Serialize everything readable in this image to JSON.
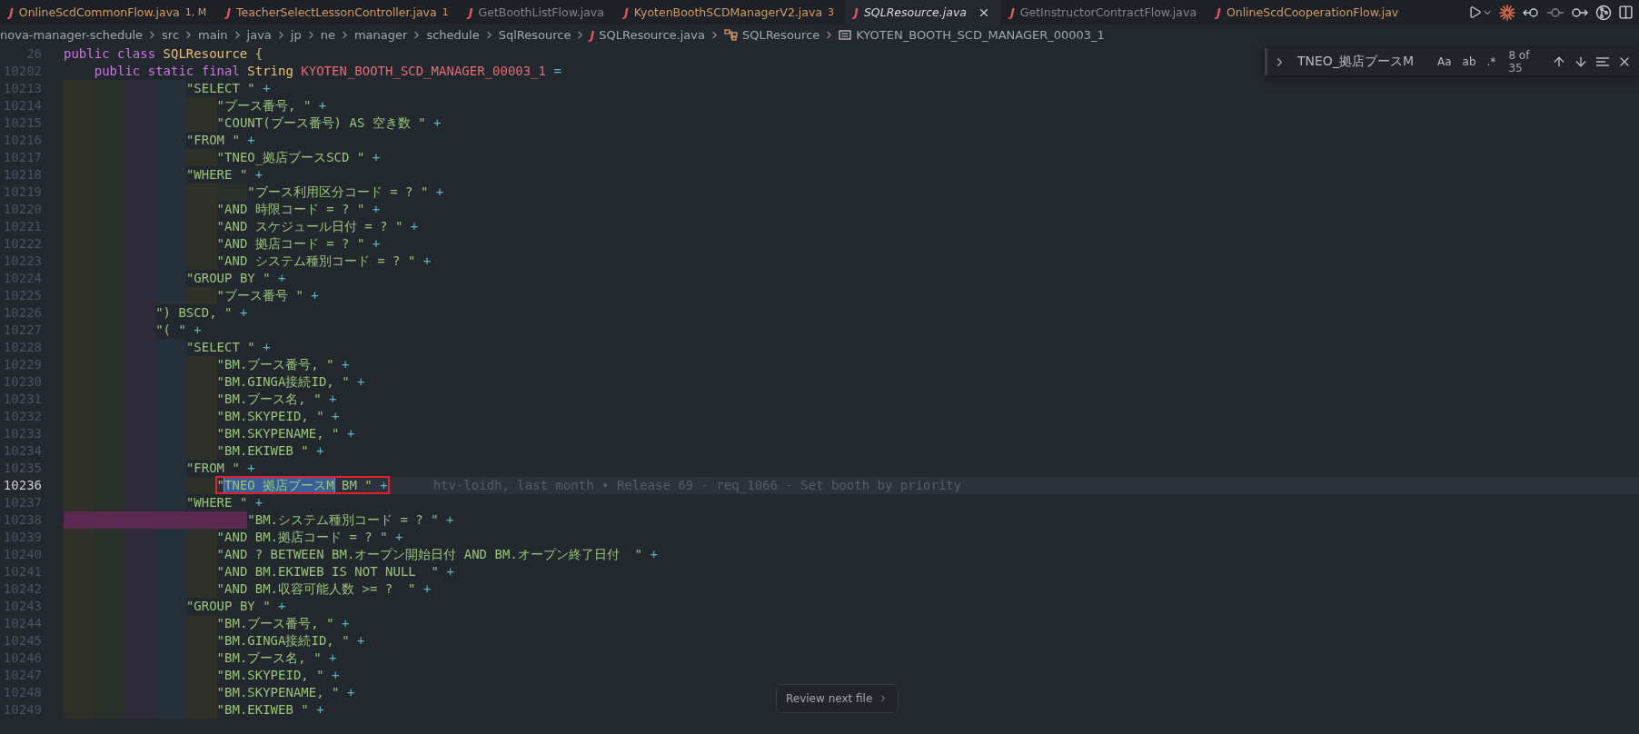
{
  "tabs": [
    {
      "icon": "J",
      "label": "OnlineScdCommonFlow.java",
      "badge": "1, M",
      "warning": true,
      "selected": false,
      "preview": false
    },
    {
      "icon": "J",
      "label": "TeacherSelectLessonController.java",
      "badge": "1",
      "warning": true,
      "selected": false,
      "preview": false
    },
    {
      "icon": "J",
      "label": "GetBoothListFlow.java",
      "warning": false,
      "selected": false,
      "preview": false
    },
    {
      "icon": "J",
      "label": "KyotenBoothSCDManagerV2.java",
      "badge": "3",
      "warning": true,
      "selected": false,
      "preview": false
    },
    {
      "icon": "J",
      "label": "SQLResource.java",
      "warning": false,
      "selected": true,
      "preview": true
    },
    {
      "icon": "J",
      "label": "GetInstructorContractFlow.java",
      "warning": false,
      "selected": false,
      "preview": false
    },
    {
      "icon": "J",
      "label": "OnlineScdCooperationFlow.jav",
      "warning": true,
      "selected": false,
      "preview": false
    }
  ],
  "breadcrumb": [
    {
      "kind": "folder",
      "label": "nova-manager-schedule"
    },
    {
      "kind": "folder",
      "label": "src"
    },
    {
      "kind": "folder",
      "label": "main"
    },
    {
      "kind": "folder",
      "label": "java"
    },
    {
      "kind": "folder",
      "label": "jp"
    },
    {
      "kind": "folder",
      "label": "ne"
    },
    {
      "kind": "folder",
      "label": "manager"
    },
    {
      "kind": "folder",
      "label": "schedule"
    },
    {
      "kind": "folder",
      "label": "SqlResource"
    },
    {
      "kind": "file",
      "icon": "J",
      "label": "SQLResource.java"
    },
    {
      "kind": "class",
      "label": "SQLResource"
    },
    {
      "kind": "field",
      "label": "KYOTEN_BOOTH_SCD_MANAGER_00003_1"
    }
  ],
  "find": {
    "expanded": false,
    "query": "TNEO_拠店ブースM",
    "options": [
      {
        "label": "Aa",
        "on": false
      },
      {
        "label": "ab",
        "on": false
      },
      {
        "label": ".*",
        "on": false
      }
    ],
    "count": "8 of 35"
  },
  "lines": [
    {
      "number": "26",
      "kind": "none",
      "current": false,
      "tokens": [
        {
          "kind": "keyword",
          "text": "public class "
        },
        {
          "kind": "type",
          "text": "SQLResource "
        },
        {
          "kind": "punct",
          "text": "{"
        }
      ]
    },
    {
      "number": "10202",
      "kind": "plain1",
      "current": false,
      "tokens": [
        {
          "kind": "keyword",
          "text": "public static final "
        },
        {
          "kind": "type",
          "text": "String "
        },
        {
          "kind": "constant",
          "text": "KYOTEN_BOOTH_SCD_MANAGER_00003_1"
        },
        {
          "kind": "op",
          "text": " ="
        }
      ]
    },
    {
      "number": "10213",
      "kind": "guides4",
      "current": false,
      "tokens": [
        {
          "kind": "string",
          "text": "\"SELECT \""
        },
        {
          "kind": "op",
          "text": " +"
        }
      ]
    },
    {
      "number": "10214",
      "kind": "guides5",
      "current": false,
      "tokens": [
        {
          "kind": "string",
          "text": "\"ブース番号, \""
        },
        {
          "kind": "op",
          "text": " +"
        }
      ]
    },
    {
      "number": "10215",
      "kind": "guides5",
      "current": false,
      "tokens": [
        {
          "kind": "string",
          "text": "\"COUNT(ブース番号) AS 空き数 \""
        },
        {
          "kind": "op",
          "text": " +"
        }
      ]
    },
    {
      "number": "10216",
      "kind": "guides4",
      "current": false,
      "tokens": [
        {
          "kind": "string",
          "text": "\"FROM \""
        },
        {
          "kind": "op",
          "text": " +"
        }
      ]
    },
    {
      "number": "10217",
      "kind": "guides5",
      "current": false,
      "tokens": [
        {
          "kind": "string",
          "text": "\"TNEO_拠店ブースSCD \""
        },
        {
          "kind": "op",
          "text": " +"
        }
      ]
    },
    {
      "number": "10218",
      "kind": "guides4",
      "current": false,
      "tokens": [
        {
          "kind": "string",
          "text": "\"WHERE \""
        },
        {
          "kind": "op",
          "text": " +"
        }
      ]
    },
    {
      "number": "10219",
      "kind": "guides6",
      "current": false,
      "tokens": [
        {
          "kind": "string",
          "text": "\"ブース利用区分コード = ? \""
        },
        {
          "kind": "op",
          "text": " +"
        }
      ]
    },
    {
      "number": "10220",
      "kind": "guides5",
      "current": false,
      "tokens": [
        {
          "kind": "string",
          "text": "\"AND 時限コード = ? \""
        },
        {
          "kind": "op",
          "text": " +"
        }
      ]
    },
    {
      "number": "10221",
      "kind": "guides5",
      "current": false,
      "tokens": [
        {
          "kind": "string",
          "text": "\"AND スケジュール日付 = ? \""
        },
        {
          "kind": "op",
          "text": " +"
        }
      ]
    },
    {
      "number": "10222",
      "kind": "guides5",
      "current": false,
      "tokens": [
        {
          "kind": "string",
          "text": "\"AND 拠店コード = ? \""
        },
        {
          "kind": "op",
          "text": " +"
        }
      ]
    },
    {
      "number": "10223",
      "kind": "guides5",
      "current": false,
      "tokens": [
        {
          "kind": "string",
          "text": "\"AND システム種別コード = ? \""
        },
        {
          "kind": "op",
          "text": " +"
        }
      ]
    },
    {
      "number": "10224",
      "kind": "guides4",
      "current": false,
      "tokens": [
        {
          "kind": "string",
          "text": "\"GROUP BY \""
        },
        {
          "kind": "op",
          "text": " +"
        }
      ]
    },
    {
      "number": "10225",
      "kind": "guides5",
      "current": false,
      "tokens": [
        {
          "kind": "string",
          "text": "\"ブース番号 \""
        },
        {
          "kind": "op",
          "text": " +"
        }
      ]
    },
    {
      "number": "10226",
      "kind": "guides3",
      "current": false,
      "tokens": [
        {
          "kind": "string",
          "text": "\") BSCD, \""
        },
        {
          "kind": "op",
          "text": " +"
        }
      ]
    },
    {
      "number": "10227",
      "kind": "guides3",
      "current": false,
      "tokens": [
        {
          "kind": "string",
          "text": "\"( \""
        },
        {
          "kind": "op",
          "text": " +"
        }
      ]
    },
    {
      "number": "10228",
      "kind": "guides4",
      "current": false,
      "tokens": [
        {
          "kind": "string",
          "text": "\"SELECT \""
        },
        {
          "kind": "op",
          "text": " +"
        }
      ]
    },
    {
      "number": "10229",
      "kind": "guides5",
      "current": false,
      "tokens": [
        {
          "kind": "string",
          "text": "\"BM.ブース番号, \""
        },
        {
          "kind": "op",
          "text": " +"
        }
      ]
    },
    {
      "number": "10230",
      "kind": "guides5",
      "current": false,
      "tokens": [
        {
          "kind": "string",
          "text": "\"BM.GINGA接続ID, \""
        },
        {
          "kind": "op",
          "text": " +"
        }
      ]
    },
    {
      "number": "10231",
      "kind": "guides5",
      "current": false,
      "tokens": [
        {
          "kind": "string",
          "text": "\"BM.ブース名, \""
        },
        {
          "kind": "op",
          "text": " +"
        }
      ]
    },
    {
      "number": "10232",
      "kind": "guides5",
      "current": false,
      "tokens": [
        {
          "kind": "string",
          "text": "\"BM.SKYPEID, \""
        },
        {
          "kind": "op",
          "text": " +"
        }
      ]
    },
    {
      "number": "10233",
      "kind": "guides5",
      "current": false,
      "tokens": [
        {
          "kind": "string",
          "text": "\"BM.SKYPENAME, \""
        },
        {
          "kind": "op",
          "text": " +"
        }
      ]
    },
    {
      "number": "10234",
      "kind": "guides5",
      "current": false,
      "tokens": [
        {
          "kind": "string",
          "text": "\"BM.EKIWEB \""
        },
        {
          "kind": "op",
          "text": " +"
        }
      ]
    },
    {
      "number": "10235",
      "kind": "guides4",
      "current": false,
      "tokens": [
        {
          "kind": "string",
          "text": "\"FROM \""
        },
        {
          "kind": "op",
          "text": " +"
        }
      ]
    },
    {
      "number": "10236",
      "kind": "guides5",
      "current": true,
      "boxed": true,
      "blame": "htv-loidh, last month • Release 69 - req_1066 - Set booth by priority",
      "tokens": [
        {
          "kind": "string",
          "text": "\""
        },
        {
          "kind": "match",
          "text": "TNEO_拠店ブースM"
        },
        {
          "kind": "string",
          "text": " BM \""
        },
        {
          "kind": "op",
          "text": " +"
        }
      ]
    },
    {
      "number": "10237",
      "kind": "guides4",
      "current": false,
      "tokens": [
        {
          "kind": "string",
          "text": "\"WHERE \""
        },
        {
          "kind": "op",
          "text": " +"
        }
      ]
    },
    {
      "number": "10238",
      "kind": "error6",
      "current": false,
      "tokens": [
        {
          "kind": "string",
          "text": "\"BM.システム種別コード = ? \""
        },
        {
          "kind": "op",
          "text": " +"
        }
      ]
    },
    {
      "number": "10239",
      "kind": "guides5",
      "current": false,
      "tokens": [
        {
          "kind": "string",
          "text": "\"AND BM.拠店コード = ? \""
        },
        {
          "kind": "op",
          "text": " +"
        }
      ]
    },
    {
      "number": "10240",
      "kind": "guides5",
      "current": false,
      "tokens": [
        {
          "kind": "string",
          "text": "\"AND ? BETWEEN BM.オープン開始日付 AND BM.オープン終了日付  \""
        },
        {
          "kind": "op",
          "text": " +"
        }
      ]
    },
    {
      "number": "10241",
      "kind": "guides5",
      "current": false,
      "tokens": [
        {
          "kind": "string",
          "text": "\"AND BM.EKIWEB IS NOT NULL  \""
        },
        {
          "kind": "op",
          "text": " +"
        }
      ]
    },
    {
      "number": "10242",
      "kind": "guides5",
      "current": false,
      "tokens": [
        {
          "kind": "string",
          "text": "\"AND BM.収容可能人数 >= ?  \""
        },
        {
          "kind": "op",
          "text": " +"
        }
      ]
    },
    {
      "number": "10243",
      "kind": "guides4",
      "current": false,
      "tokens": [
        {
          "kind": "string",
          "text": "\"GROUP BY \""
        },
        {
          "kind": "op",
          "text": " +"
        }
      ]
    },
    {
      "number": "10244",
      "kind": "guides5",
      "current": false,
      "tokens": [
        {
          "kind": "string",
          "text": "\"BM.ブース番号, \""
        },
        {
          "kind": "op",
          "text": " +"
        }
      ]
    },
    {
      "number": "10245",
      "kind": "guides5",
      "current": false,
      "tokens": [
        {
          "kind": "string",
          "text": "\"BM.GINGA接続ID, \""
        },
        {
          "kind": "op",
          "text": " +"
        }
      ]
    },
    {
      "number": "10246",
      "kind": "guides5",
      "current": false,
      "tokens": [
        {
          "kind": "string",
          "text": "\"BM.ブース名, \""
        },
        {
          "kind": "op",
          "text": " +"
        }
      ]
    },
    {
      "number": "10247",
      "kind": "guides5",
      "current": false,
      "tokens": [
        {
          "kind": "string",
          "text": "\"BM.SKYPEID, \""
        },
        {
          "kind": "op",
          "text": " +"
        }
      ]
    },
    {
      "number": "10248",
      "kind": "guides5",
      "current": false,
      "tokens": [
        {
          "kind": "string",
          "text": "\"BM.SKYPENAME, \""
        },
        {
          "kind": "op",
          "text": " +"
        }
      ]
    },
    {
      "number": "10249",
      "kind": "guides5",
      "current": false,
      "tokens": [
        {
          "kind": "string",
          "text": "\"BM.EKIWEB \""
        },
        {
          "kind": "op",
          "text": " +"
        }
      ]
    }
  ],
  "review_button": {
    "label": "Review next file"
  }
}
